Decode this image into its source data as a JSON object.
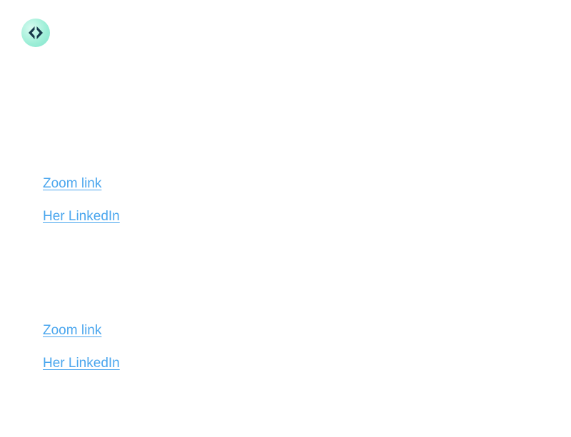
{
  "logo": {
    "icon": "diamond-arrows-icon",
    "colors": {
      "bg": "#9fefd8",
      "fg": "#17384a"
    }
  },
  "sections": [
    {
      "zoom_label": "Zoom link",
      "linkedin_label": "Her LinkedIn"
    },
    {
      "zoom_label": "Zoom link",
      "linkedin_label": "Her LinkedIn"
    }
  ],
  "link_color": "#4aa6ee"
}
